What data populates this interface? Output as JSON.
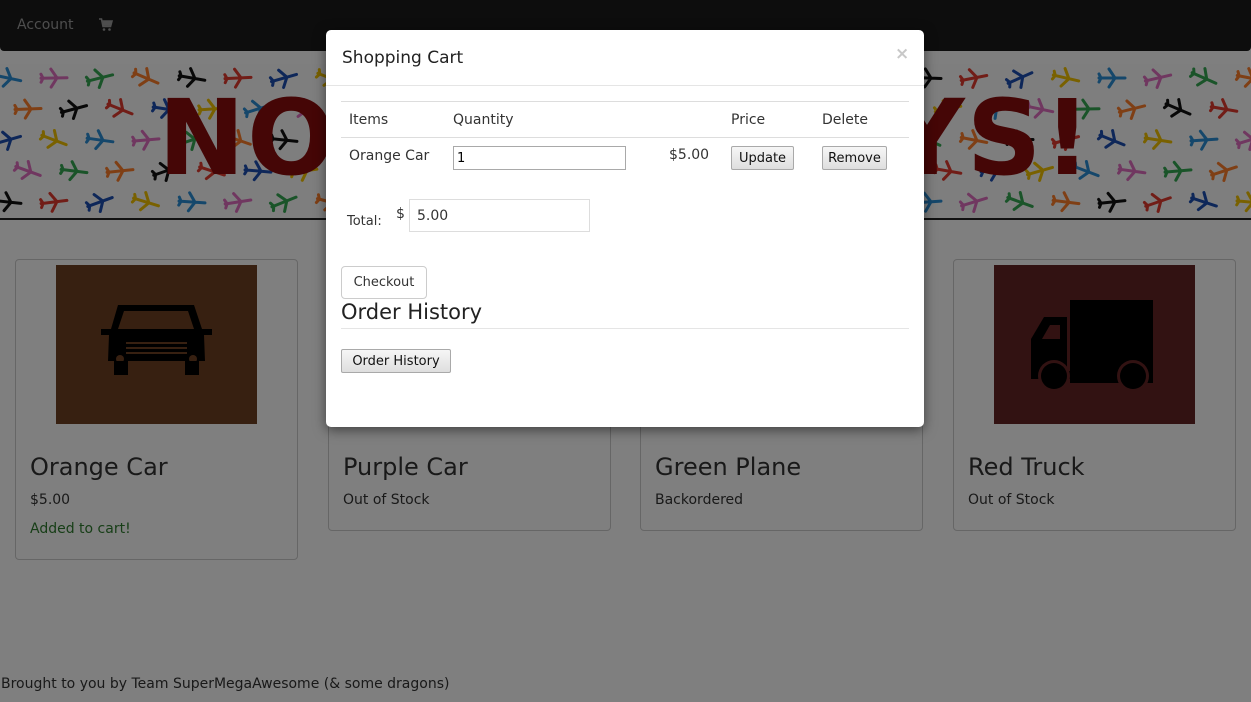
{
  "navbar": {
    "account_label": "Account",
    "cart_icon": "cart-icon"
  },
  "banner": {
    "title": "NOVELTY TOYS!"
  },
  "products": [
    {
      "name": "Orange Car",
      "status": "$5.00",
      "note": "Added to cart!",
      "image_color": "#6f4123"
    },
    {
      "name": "Purple Car",
      "status": "Out of Stock",
      "note": ""
    },
    {
      "name": "Green Plane",
      "status": "Backordered",
      "note": ""
    },
    {
      "name": "Red Truck",
      "status": "Out of Stock",
      "note": "",
      "image_color": "#642525"
    }
  ],
  "footer": {
    "text": "Brought to you by Team SuperMegaAwesome (& some dragons)"
  },
  "modal": {
    "title": "Shopping Cart",
    "close_glyph": "×",
    "columns": [
      "Items",
      "Quantity",
      "Price",
      "Delete"
    ],
    "rows": [
      {
        "item": "Orange Car",
        "quantity": "1",
        "price": "$5.00",
        "update_label": "Update",
        "remove_label": "Remove"
      }
    ],
    "total_label": "Total:",
    "currency_symbol": "$",
    "total_value": "5.00",
    "checkout_label": "Checkout",
    "order_history_heading": "Order History",
    "order_history_button": "Order History"
  },
  "colors": {
    "navbar": "#1a1a1a",
    "banner_title": "#8b0d0d",
    "orange_car_bg": "#6f4123",
    "red_truck_bg": "#642525",
    "added_to_cart": "#2e7d2e"
  }
}
